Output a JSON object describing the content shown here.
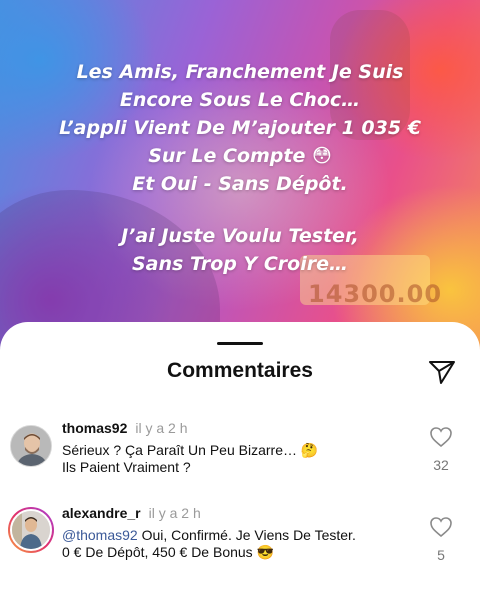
{
  "post": {
    "caption_lines": [
      "Les Amis, Franchement Je Suis",
      "Encore Sous Le Choc…",
      "L’appli Vient De M’ajouter 1 035 €",
      "Sur Le Compte 😳",
      "Et Oui - Sans Dépôt."
    ],
    "caption_lines_2": [
      "J’ai Juste Voulu Tester,",
      "Sans Trop Y Croire…"
    ],
    "background_text": "14300.00"
  },
  "comments_sheet": {
    "title": "Commentaires",
    "share_icon": "send-icon"
  },
  "comments": [
    {
      "username": "thomas92",
      "time": "il y a 2 h",
      "mention": "",
      "lines": [
        "Sérieux ? Ça Paraît Un Peu Bizarre… 🤔",
        "Ils Paient Vraiment ?"
      ],
      "likes": "32",
      "like_icon": "heart-icon"
    },
    {
      "username": "alexandre_r",
      "time": "il y a 2 h",
      "mention": "@thomas92",
      "lines": [
        " Oui, Confirmé. Je Viens De Tester.",
        "0 € De Dépôt, 450 € De Bonus 😎"
      ],
      "likes": "5",
      "like_icon": "heart-icon"
    }
  ],
  "colors": {
    "mention": "#3b5998",
    "story_ring": [
      "#f9a03f",
      "#e1306c",
      "#a63fd8"
    ]
  }
}
